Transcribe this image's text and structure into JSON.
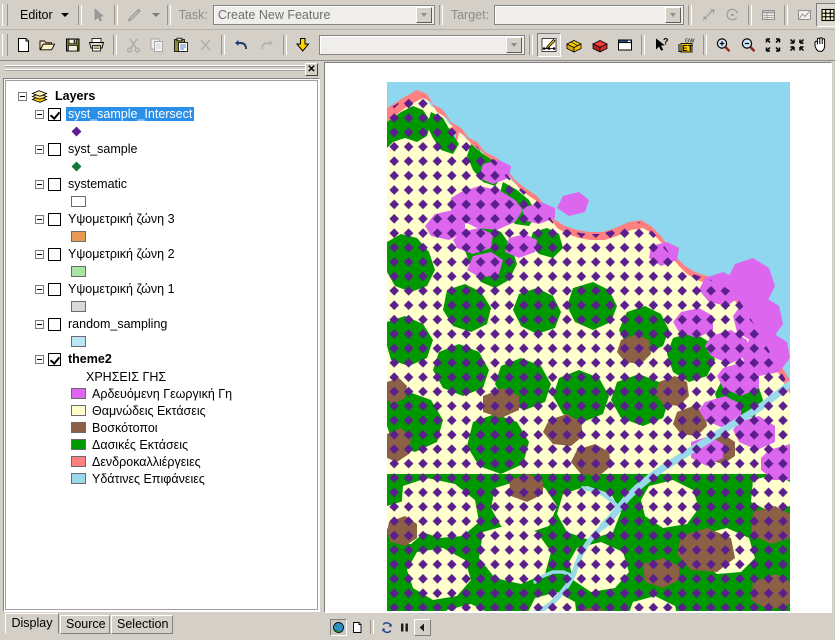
{
  "editor_toolbar": {
    "menu_label": "Editor",
    "menu_accesskey": "r",
    "task_label": "Task:",
    "task_value": "Create New Feature",
    "target_label": "Target:",
    "target_value": "",
    "buttons": [
      {
        "name": "edit-tool-arrow",
        "title": "Edit Tool"
      },
      {
        "name": "sketch-tool-pencil",
        "title": "Sketch Tool"
      },
      {
        "name": "split-tool",
        "title": "Split"
      },
      {
        "name": "rotate-tool",
        "title": "Rotate"
      },
      {
        "name": "attributes",
        "title": "Attributes"
      },
      {
        "name": "sketch-properties",
        "title": "Sketch Properties"
      },
      {
        "name": "snapping",
        "title": "Snapping"
      },
      {
        "name": "dimension-tool",
        "title": "Dimension"
      },
      {
        "name": "trace-tool",
        "title": "Trace"
      },
      {
        "name": "endpoint-arc-tool",
        "title": "Endpoint Arc"
      }
    ]
  },
  "standard_toolbar": {
    "combo_value": "",
    "buttons": [
      {
        "name": "new-document-icon",
        "title": "New"
      },
      {
        "name": "open-folder-icon",
        "title": "Open"
      },
      {
        "name": "save-floppy-icon",
        "title": "Save"
      },
      {
        "name": "print-icon",
        "title": "Print"
      },
      {
        "name": "cut-scissors-icon",
        "title": "Cut"
      },
      {
        "name": "copy-icon",
        "title": "Copy"
      },
      {
        "name": "paste-clipboard-icon",
        "title": "Paste"
      },
      {
        "name": "delete-x-icon",
        "title": "Delete"
      },
      {
        "name": "undo-arrow-icon",
        "title": "Undo"
      },
      {
        "name": "redo-arrow-icon",
        "title": "Redo"
      },
      {
        "name": "add-data-icon",
        "title": "Add Data"
      },
      {
        "name": "editor-toolbar-icon",
        "title": "Editor Toolbar"
      },
      {
        "name": "toolbox-icon",
        "title": "ArcToolbox"
      },
      {
        "name": "model-builder-icon",
        "title": "ModelBuilder"
      },
      {
        "name": "command-window-icon",
        "title": "Command Line"
      },
      {
        "name": "select-elements-icon",
        "title": "Select Elements"
      },
      {
        "name": "what-is-this-help-icon",
        "title": "What's This?"
      },
      {
        "name": "et-geowizards-icon",
        "title": "ET GeoWizards"
      },
      {
        "name": "zoom-in-icon",
        "title": "Zoom In"
      },
      {
        "name": "zoom-out-icon",
        "title": "Zoom Out"
      },
      {
        "name": "fixed-zoom-in-icon",
        "title": "Fixed Zoom In"
      },
      {
        "name": "fixed-zoom-out-icon",
        "title": "Fixed Zoom Out"
      },
      {
        "name": "pan-hand-icon",
        "title": "Pan"
      },
      {
        "name": "full-extent-globe-icon",
        "title": "Full Extent"
      },
      {
        "name": "back-extent-icon",
        "title": "Go Back To Previous Extent"
      },
      {
        "name": "forward-extent-icon",
        "title": "Go To Next Extent"
      },
      {
        "name": "select-features-icon",
        "title": "Select Features"
      }
    ]
  },
  "toc": {
    "title": "",
    "close_label": "✕",
    "root": {
      "label": "Layers",
      "icon": "layers-stack-icon"
    },
    "layers": [
      {
        "label": "syst_sample_Intersect",
        "checked": true,
        "selected": true,
        "symbol": {
          "kind": "point",
          "color": "#5a1f8c"
        }
      },
      {
        "label": "syst_sample",
        "checked": false,
        "selected": false,
        "symbol": {
          "kind": "point",
          "color": "#13783a"
        }
      },
      {
        "label": "systematic",
        "checked": false,
        "selected": false,
        "symbol": {
          "kind": "box",
          "color": "#ffffff"
        }
      },
      {
        "label": "Υψομετρική ζώνη 3",
        "checked": false,
        "selected": false,
        "symbol": {
          "kind": "box",
          "color": "#e89a52"
        }
      },
      {
        "label": "Υψομετρική ζώνη 2",
        "checked": false,
        "selected": false,
        "symbol": {
          "kind": "box",
          "color": "#a9e4a4"
        }
      },
      {
        "label": "Υψομετρική ζώνη 1",
        "checked": false,
        "selected": false,
        "symbol": {
          "kind": "box",
          "color": "#d8d8d8"
        }
      },
      {
        "label": "random_sampling",
        "checked": false,
        "selected": false,
        "symbol": {
          "kind": "box",
          "color": "#b8e6f5"
        }
      }
    ],
    "theme": {
      "label": "theme2",
      "checked": true,
      "field_heading": "ΧΡΗΣΕΙΣ ΓΗΣ",
      "classes": [
        {
          "label": "Αρδευόμενη Γεωργική Γη",
          "color": "#dd66ee"
        },
        {
          "label": "Θαμνώδεις Εκτάσεις",
          "color": "#ffffcc"
        },
        {
          "label": "Βοσκότοποι",
          "color": "#8b6044"
        },
        {
          "label": "Δασικές Εκτάσεις",
          "color": "#009900"
        },
        {
          "label": "Δενδροκαλλιέργειες",
          "color": "#ff8080"
        },
        {
          "label": "Υδάτινες Επιφάνειες",
          "color": "#99d9ea"
        }
      ]
    },
    "tabs": [
      {
        "label": "Display",
        "active": true
      },
      {
        "label": "Source",
        "active": false
      },
      {
        "label": "Selection",
        "active": false
      }
    ]
  },
  "map": {
    "background_color": "#ffffff",
    "water_color": "#99d9ea",
    "sea_color": "#8fd6ef",
    "sample_point_color": "#5a1f8c",
    "bottom_bar_buttons": [
      {
        "name": "data-view-globe-icon",
        "title": "Data View",
        "state": "sunken"
      },
      {
        "name": "layout-view-page-icon",
        "title": "Layout View",
        "state": "flat"
      },
      {
        "name": "refresh-icon",
        "title": "Refresh View",
        "state": "flat"
      },
      {
        "name": "pause-drawing-icon",
        "title": "Pause Drawing",
        "state": "flat"
      },
      {
        "name": "toggle-toc-icon",
        "title": "Toggle Contents",
        "state": "raised"
      }
    ]
  },
  "colors": {
    "window_face": "#d4d0c8",
    "selection_blue": "#2a8fe8",
    "text": "#000000",
    "disabled_text": "#8d8d8d"
  }
}
